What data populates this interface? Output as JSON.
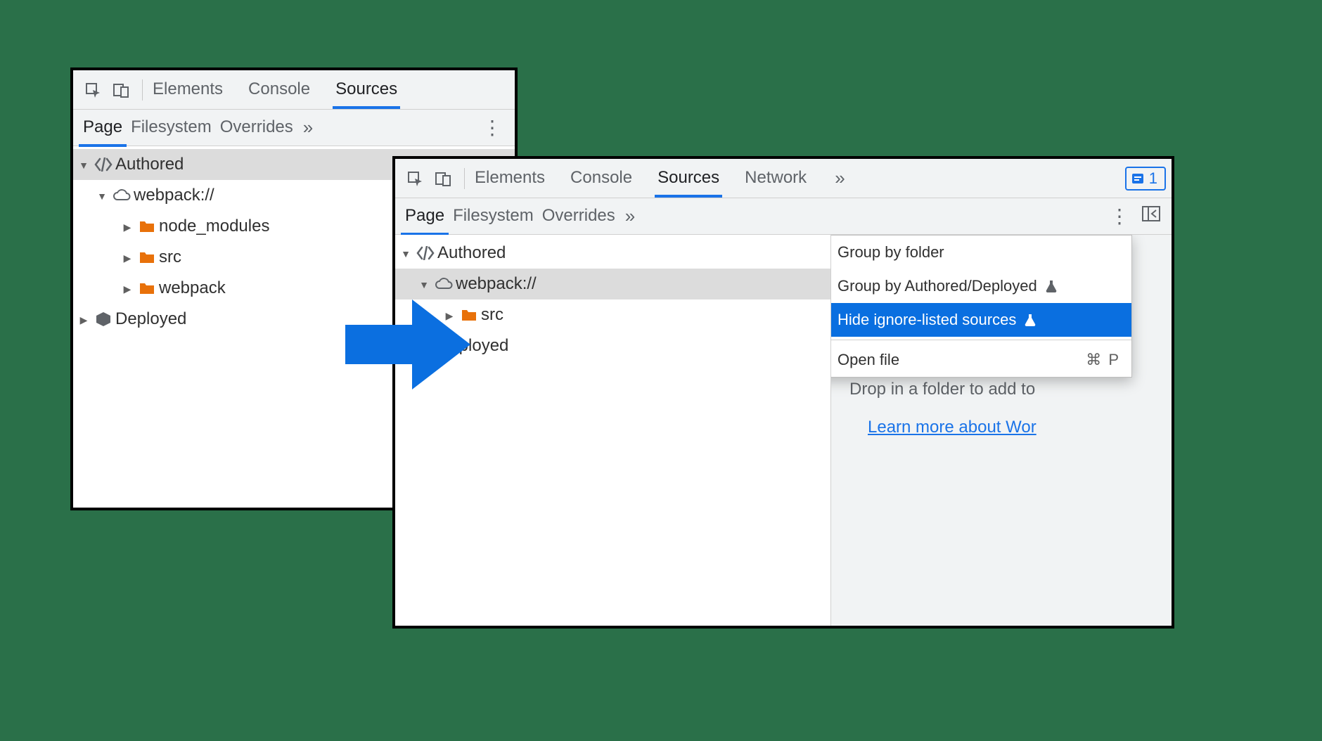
{
  "panel1": {
    "tabs": [
      "Elements",
      "Console",
      "Sources"
    ],
    "active_tab": "Sources",
    "subtabs": [
      "Page",
      "Filesystem",
      "Overrides"
    ],
    "active_subtab": "Page",
    "tree": {
      "authored": "Authored",
      "webpack": "webpack://",
      "folders": [
        "node_modules",
        "src",
        "webpack"
      ],
      "deployed": "Deployed"
    }
  },
  "panel2": {
    "tabs": [
      "Elements",
      "Console",
      "Sources",
      "Network"
    ],
    "active_tab": "Sources",
    "subtabs": [
      "Page",
      "Filesystem",
      "Overrides"
    ],
    "active_subtab": "Page",
    "issues_count": "1",
    "tree": {
      "authored": "Authored",
      "webpack": "webpack://",
      "src": "src",
      "deployed": "Deployed"
    },
    "menu": {
      "group_by_folder": "Group by folder",
      "group_by_ad": "Group by Authored/Deployed",
      "hide_ignored": "Hide ignore-listed sources",
      "open_file": "Open file",
      "open_file_shortcut": "⌘ P"
    },
    "right_pane": {
      "drop_text": "Drop in a folder to add to",
      "learn_more": "Learn more about Wor"
    }
  }
}
